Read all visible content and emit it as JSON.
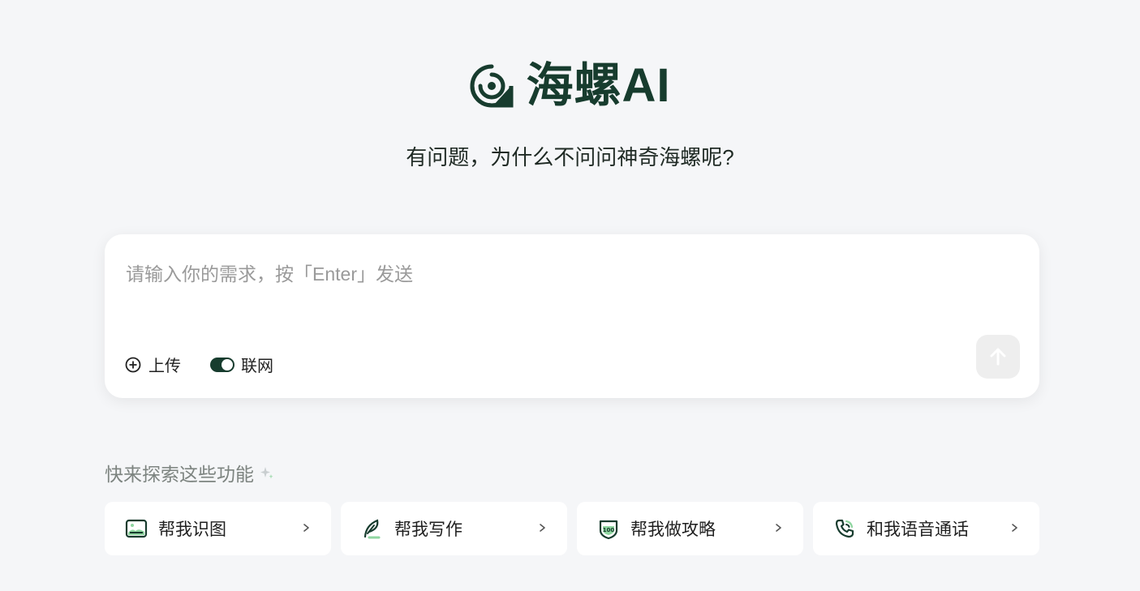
{
  "brand": {
    "name": "海螺AI",
    "tagline": "有问题，为什么不问问神奇海螺呢?"
  },
  "composer": {
    "placeholder": "请输入你的需求，按「Enter」发送",
    "value": "",
    "upload_label": "上传",
    "web_label": "联网",
    "web_enabled": true
  },
  "explore": {
    "title": "快来探索这些功能",
    "items": [
      {
        "label": "帮我识图",
        "icon": "image-icon"
      },
      {
        "label": "帮我写作",
        "icon": "quill-icon"
      },
      {
        "label": "帮我做攻略",
        "icon": "guide-badge-icon"
      },
      {
        "label": "和我语音通话",
        "icon": "phone-call-icon"
      }
    ]
  },
  "colors": {
    "brand": "#173c2e",
    "accent_light": "#8fd6a0",
    "background": "#f5f6f8"
  }
}
